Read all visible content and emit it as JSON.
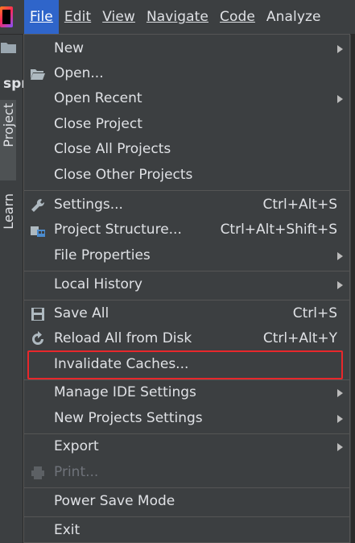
{
  "menubar": {
    "items": [
      {
        "label": "File",
        "active": true
      },
      {
        "label": "Edit",
        "active": false
      },
      {
        "label": "View",
        "active": false
      },
      {
        "label": "Navigate",
        "active": false
      },
      {
        "label": "Code",
        "active": false
      },
      {
        "label": "Analyze",
        "active": false
      }
    ]
  },
  "sidebar": {
    "project_crumb": "spr",
    "tabs": [
      {
        "label": "Project"
      },
      {
        "label": "Learn"
      }
    ]
  },
  "file_menu": {
    "new": {
      "label": "New",
      "submenu": true
    },
    "open": {
      "label": "Open...",
      "icon": "folder-open-icon"
    },
    "open_recent": {
      "label": "Open Recent",
      "submenu": true
    },
    "close_project": {
      "label": "Close Project"
    },
    "close_all_projects": {
      "label": "Close All Projects"
    },
    "close_other_projects": {
      "label": "Close Other Projects"
    },
    "settings": {
      "label": "Settings...",
      "shortcut": "Ctrl+Alt+S",
      "icon": "wrench-icon"
    },
    "project_structure": {
      "label": "Project Structure...",
      "shortcut": "Ctrl+Alt+Shift+S",
      "icon": "project-structure-icon"
    },
    "file_properties": {
      "label": "File Properties",
      "submenu": true
    },
    "local_history": {
      "label": "Local History",
      "submenu": true
    },
    "save_all": {
      "label": "Save All",
      "shortcut": "Ctrl+S",
      "icon": "save-icon"
    },
    "reload_all": {
      "label": "Reload All from Disk",
      "shortcut": "Ctrl+Alt+Y",
      "icon": "reload-icon"
    },
    "invalidate_caches": {
      "label": "Invalidate Caches...",
      "highlighted": true
    },
    "manage_ide_settings": {
      "label": "Manage IDE Settings",
      "submenu": true
    },
    "new_projects_settings": {
      "label": "New Projects Settings",
      "submenu": true
    },
    "export": {
      "label": "Export",
      "submenu": true
    },
    "print": {
      "label": "Print...",
      "disabled": true,
      "icon": "printer-icon"
    },
    "power_save_mode": {
      "label": "Power Save Mode"
    },
    "exit": {
      "label": "Exit"
    }
  },
  "colors": {
    "menu_background": "#3c3f41",
    "active_menu": "#2f65ca",
    "text": "#dfe1e5",
    "disabled_text": "#6f737a",
    "highlight_border": "#e8272b"
  }
}
